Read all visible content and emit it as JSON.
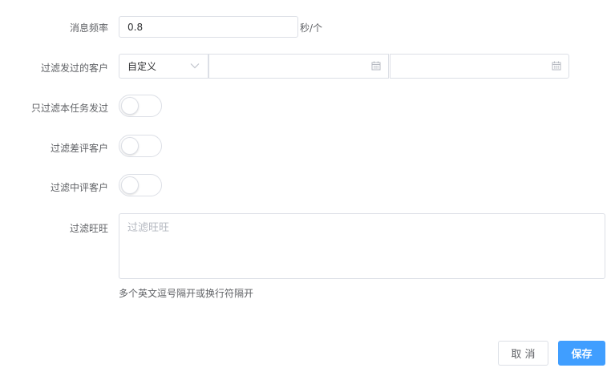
{
  "form": {
    "frequency": {
      "label": "消息频率",
      "value": "0.8",
      "unit": "秒/个"
    },
    "filter_sent": {
      "label": "过滤发过的客户",
      "select_value": "自定义",
      "date_start": "",
      "date_end": ""
    },
    "filter_task_sent": {
      "label": "只过滤本任务发过",
      "on": false
    },
    "filter_bad_review": {
      "label": "过滤差评客户",
      "on": false
    },
    "filter_mid_review": {
      "label": "过滤中评客户",
      "on": false
    },
    "filter_wangwang": {
      "label": "过滤旺旺",
      "placeholder": "过滤旺旺",
      "hint": "多个英文逗号隔开或换行符隔开"
    }
  },
  "buttons": {
    "cancel": "取 消",
    "save": "保存"
  },
  "colors": {
    "primary": "#409eff",
    "border": "#dcdfe6",
    "label": "#606266"
  },
  "icons": {
    "select": "chevron-down-icon",
    "date": "calendar-icon"
  }
}
